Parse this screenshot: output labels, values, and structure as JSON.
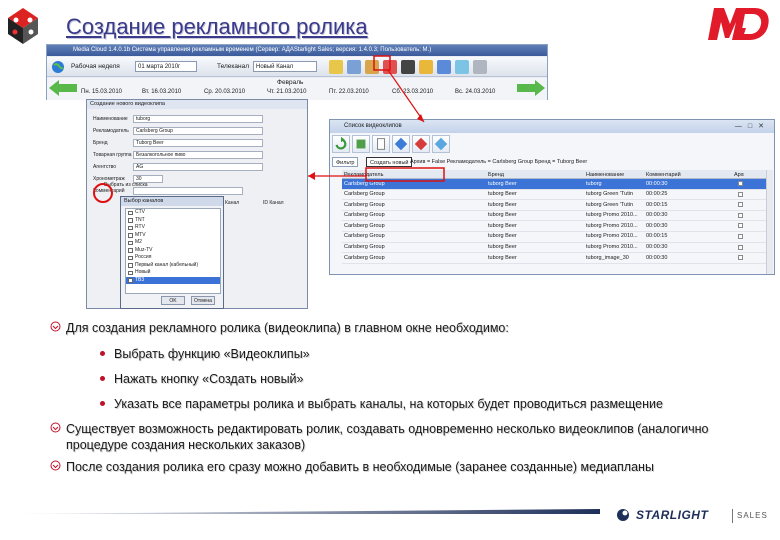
{
  "slide": {
    "title": "Создание рекламного ролика",
    "footer_brand": "STARLIGHT",
    "footer_sub": "SALES"
  },
  "colors": {
    "title": "#3a3a8c",
    "accent": "#c0112b",
    "selection": "#3b73d6"
  },
  "app": {
    "window_title": "Media Cloud 1.4.0.1b Система управления рекламным временем (Сервер: АДАStarlight Sales; версия: 1.4.0.3; Пользователь: M.)",
    "week_label": "Рабочая неделя",
    "week_value": "01 марта 2010г",
    "channel_label": "Телеканал",
    "channel_value": "Новый Канал",
    "week_header": "Февраль",
    "days": [
      "Пн. 15.03.2010",
      "Вт. 16.03.2010",
      "Ср. 20.03.2010",
      "Чт. 21.03.2010",
      "Пт. 22.03.2010",
      "Сб. 23.03.2010",
      "Вс. 24.03.2010"
    ]
  },
  "create_dialog": {
    "title": "Создание нового видеоклипа",
    "fields": [
      {
        "label": "Наименование",
        "value": "tuborg"
      },
      {
        "label": "Рекламодатель",
        "value": "Carlsberg Group"
      },
      {
        "label": "Бренд",
        "value": "Tuborg Beer"
      },
      {
        "label": "Товарная группа",
        "value": "Безалкогольное пиво"
      },
      {
        "label": "Агентство",
        "value": "AG"
      },
      {
        "label": "Хронометраж",
        "value": "30"
      },
      {
        "label": "Комментарий",
        "value": ""
      }
    ],
    "checkbox_label": "Выбрать из списка",
    "grid_columns": [
      "Канал",
      "ID Канал"
    ]
  },
  "channels_dialog": {
    "title": "Выбор каналов",
    "items": [
      {
        "label": "CTV",
        "selected": false
      },
      {
        "label": "TNT",
        "selected": false
      },
      {
        "label": "RTV",
        "selected": false
      },
      {
        "label": "MTV",
        "selected": false
      },
      {
        "label": "M2",
        "selected": false
      },
      {
        "label": "Muz-TV",
        "selected": false
      },
      {
        "label": "Россия",
        "selected": false
      },
      {
        "label": "Первый канал (кабельный)",
        "selected": false
      },
      {
        "label": "Новый",
        "selected": false
      },
      {
        "label": "ТВ3",
        "selected": true
      }
    ],
    "ok_label": "OK",
    "cancel_label": "Отмена"
  },
  "video_window": {
    "title": "Список видеоклипов",
    "filter_button": "Фильтр",
    "create_button": "Создать новый",
    "filter_text": "Архив = False   Рекламодатель = Carlsberg Group   Бренд = Tuborg Beer",
    "columns": [
      "Рекламодатель",
      "Бренд",
      "Наименование",
      "Комментарий",
      "",
      "Архив"
    ],
    "rows": [
      {
        "advertiser": "Carlsberg Group",
        "brand": "tuborg Beer",
        "name": "tuborg",
        "comment": "00:00:30",
        "selected": true
      },
      {
        "advertiser": "Carlsberg Group",
        "brand": "tuborg Beer",
        "name": "tuborg Green 'Tutin",
        "comment": "00:00:25",
        "selected": false
      },
      {
        "advertiser": "Carlsberg Group",
        "brand": "tuborg Beer",
        "name": "tuborg Green 'Tutin",
        "comment": "00:00:15",
        "selected": false
      },
      {
        "advertiser": "Carlsberg Group",
        "brand": "tuborg Beer",
        "name": "tuborg Promo 2010...",
        "comment": "00:00:30",
        "selected": false
      },
      {
        "advertiser": "Carlsberg Group",
        "brand": "tuborg Beer",
        "name": "tuborg Promo 2010...",
        "comment": "00:00:30",
        "selected": false
      },
      {
        "advertiser": "Carlsberg Group",
        "brand": "tuborg Beer",
        "name": "tuborg Promo 2010...",
        "comment": "00:00:15",
        "selected": false
      },
      {
        "advertiser": "Carlsberg Group",
        "brand": "tuborg Beer",
        "name": "tuborg Promo 2010...",
        "comment": "00:00:30",
        "selected": false
      },
      {
        "advertiser": "Carlsberg Group",
        "brand": "tuborg Beer",
        "name": "tuborg_image_30",
        "comment": "00:00:30",
        "selected": false
      }
    ]
  },
  "bullets": [
    {
      "text": "Для создания рекламного ролика (видеоклипа) в главном окне необходимо:",
      "sub": [
        "Выбрать функцию «Видеоклипы»",
        "Нажать кнопку «Создать новый»",
        "Указать все параметры ролика и выбрать каналы, на которых будет проводиться размещение"
      ]
    },
    {
      "text": "Существует возможность редактировать ролик, создавать одновременно несколько видеоклипов (аналогично процедуре создания нескольких заказов)",
      "sub": []
    },
    {
      "text": "После создания ролика его сразу можно добавить в необходимые (заранее созданные) медиапланы",
      "sub": []
    }
  ]
}
